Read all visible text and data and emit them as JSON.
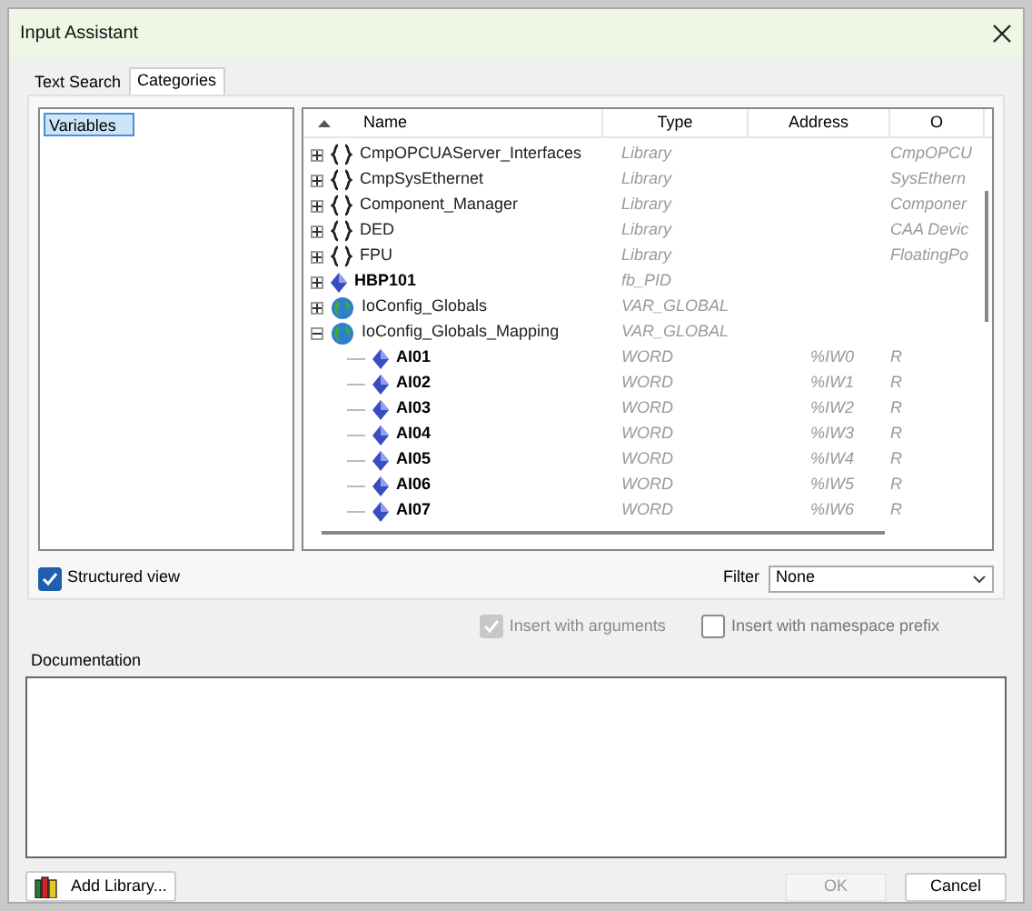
{
  "window": {
    "title": "Input Assistant"
  },
  "tabs": [
    {
      "label": "Text Search",
      "selected": false
    },
    {
      "label": "Categories",
      "selected": true
    }
  ],
  "categories": [
    {
      "label": "Variables",
      "selected": true
    }
  ],
  "tree": {
    "columns": [
      "Name",
      "Type",
      "Address",
      "O"
    ],
    "rows": [
      {
        "kind": "library",
        "name": "CmpOPCUAServer_Interfaces",
        "type": "Library",
        "origin": "CmpOPCU",
        "expanded": false
      },
      {
        "kind": "library",
        "name": "CmpSysEthernet",
        "type": "Library",
        "origin": "SysEthern",
        "expanded": false
      },
      {
        "kind": "library",
        "name": "Component_Manager",
        "type": "Library",
        "origin": "Componer",
        "expanded": false
      },
      {
        "kind": "library",
        "name": "DED",
        "type": "Library",
        "origin": "CAA Devic",
        "expanded": false
      },
      {
        "kind": "library",
        "name": "FPU",
        "type": "Library",
        "origin": "FloatingPo",
        "expanded": false
      },
      {
        "kind": "instance",
        "name": "HBP101",
        "type": "fb_PID",
        "expanded": false
      },
      {
        "kind": "globals",
        "name": "IoConfig_Globals",
        "type": "VAR_GLOBAL",
        "expanded": false
      },
      {
        "kind": "globals",
        "name": "IoConfig_Globals_Mapping",
        "type": "VAR_GLOBAL",
        "expanded": true,
        "children": [
          {
            "kind": "instance",
            "name": "AI01",
            "type": "WORD",
            "address": "%IW0",
            "origin": "R"
          },
          {
            "kind": "instance",
            "name": "AI02",
            "type": "WORD",
            "address": "%IW1",
            "origin": "R"
          },
          {
            "kind": "instance",
            "name": "AI03",
            "type": "WORD",
            "address": "%IW2",
            "origin": "R"
          },
          {
            "kind": "instance",
            "name": "AI04",
            "type": "WORD",
            "address": "%IW3",
            "origin": "R"
          },
          {
            "kind": "instance",
            "name": "AI05",
            "type": "WORD",
            "address": "%IW4",
            "origin": "R"
          },
          {
            "kind": "instance",
            "name": "AI06",
            "type": "WORD",
            "address": "%IW5",
            "origin": "R"
          },
          {
            "kind": "instance",
            "name": "AI07",
            "type": "WORD",
            "address": "%IW6",
            "origin": "R"
          }
        ]
      }
    ]
  },
  "structured_view": {
    "label": "Structured view",
    "checked": true
  },
  "filter": {
    "label": "Filter",
    "value": "None"
  },
  "options": [
    {
      "label": "Insert with arguments",
      "checked": true,
      "disabled": true
    },
    {
      "label": "Insert with namespace prefix",
      "checked": false,
      "disabled": false
    }
  ],
  "documentation": {
    "label": "Documentation"
  },
  "buttons": {
    "add_library": "Add Library...",
    "ok": {
      "label": "OK",
      "disabled": true
    },
    "cancel": {
      "label": "Cancel",
      "disabled": false
    }
  }
}
